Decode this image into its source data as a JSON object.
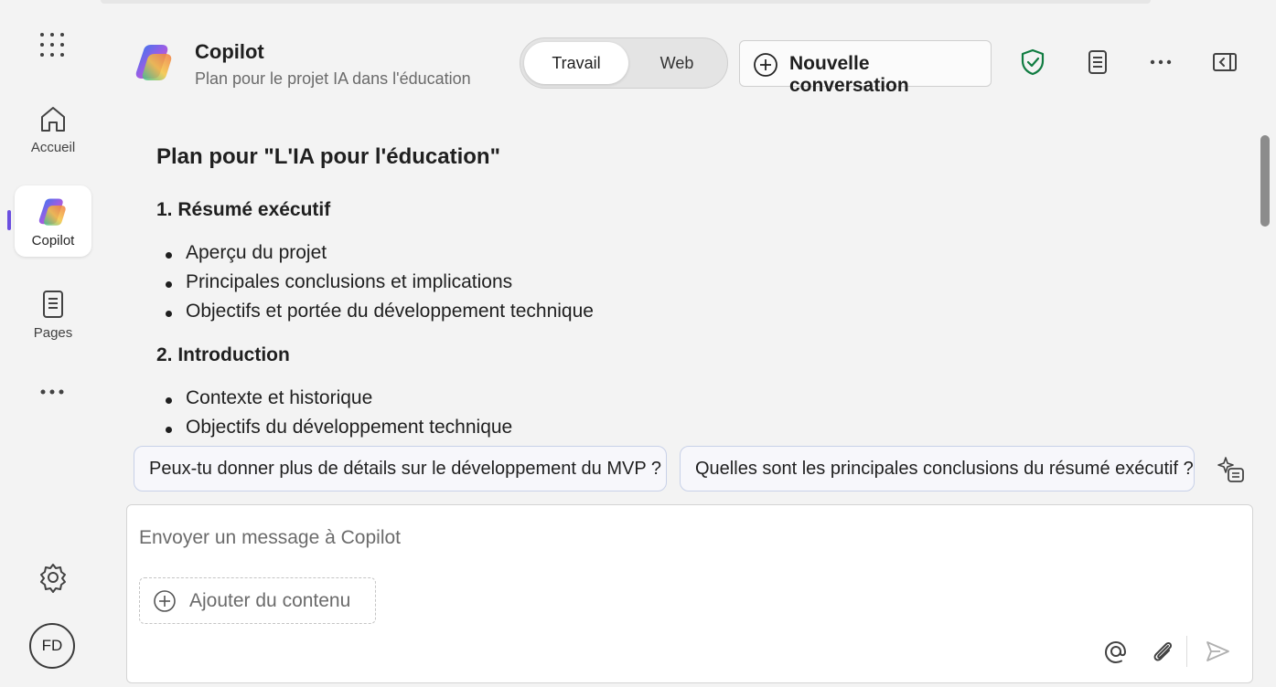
{
  "header": {
    "title": "Copilot",
    "subtitle": "Plan pour le projet IA dans l'éducation",
    "mode_toggle": {
      "options": [
        "Travail",
        "Web"
      ],
      "selected": "Travail"
    },
    "new_conversation_label": "Nouvelle conversation",
    "icons": [
      "shield-check-icon",
      "notes-icon",
      "more-icon",
      "panel-icon"
    ],
    "shield_color": "#107c41"
  },
  "sidebar": {
    "items": [
      {
        "label": "Accueil",
        "icon": "home-icon"
      },
      {
        "label": "Copilot",
        "icon": "copilot-logo-icon",
        "active": true
      },
      {
        "label": "Pages",
        "icon": "pages-icon"
      }
    ],
    "avatar_initials": "FD",
    "accent_color": "#6b4fe0"
  },
  "content": {
    "title": "Plan pour \"L'IA pour l'éducation\"",
    "sections": [
      {
        "heading": "1. Résumé exécutif",
        "bullets": [
          "Aperçu du projet",
          "Principales conclusions et implications",
          "Objectifs et portée du développement technique"
        ]
      },
      {
        "heading": "2. Introduction",
        "bullets": [
          "Contexte et historique",
          "Objectifs du développement technique"
        ]
      }
    ]
  },
  "suggestions": [
    "Peux-tu donner plus de détails sur le développement du MVP ?",
    "Quelles sont les principales conclusions du résumé exécutif ?"
  ],
  "composer": {
    "placeholder": "Envoyer un message à Copilot",
    "add_content_label": "Ajouter du contenu",
    "icons": [
      "mention-icon",
      "attach-icon",
      "send-icon"
    ]
  }
}
